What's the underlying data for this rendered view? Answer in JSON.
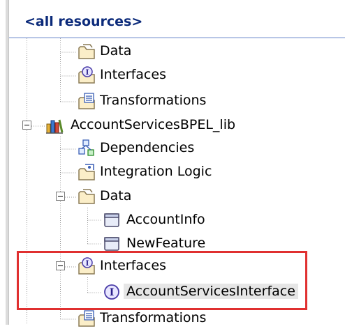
{
  "header": {
    "title": "<all resources>"
  },
  "tree": {
    "items": [
      {
        "label": "Data",
        "icon": "folder-icon"
      },
      {
        "label": "Interfaces",
        "icon": "interface-folder-icon"
      },
      {
        "label": "Transformations",
        "icon": "transformations-icon"
      },
      {
        "label": "AccountServicesBPEL_lib",
        "icon": "library-icon",
        "expanded": true
      },
      {
        "label": "Dependencies",
        "icon": "dependencies-icon"
      },
      {
        "label": "Integration Logic",
        "icon": "integration-logic-icon"
      },
      {
        "label": "Data",
        "icon": "folder-icon",
        "expanded": true
      },
      {
        "label": "AccountInfo",
        "icon": "business-object-icon"
      },
      {
        "label": "NewFeature",
        "icon": "business-object-icon"
      },
      {
        "label": "Interfaces",
        "icon": "interface-folder-icon",
        "expanded": true
      },
      {
        "label": "AccountServicesInterface",
        "icon": "interface-icon",
        "selected": true
      },
      {
        "label": "Transformations",
        "icon": "transformations-icon"
      }
    ]
  },
  "colors": {
    "header_text": "#0b2a7a",
    "highlight_box": "#e03030",
    "selection_bg": "#e6e6e6"
  }
}
